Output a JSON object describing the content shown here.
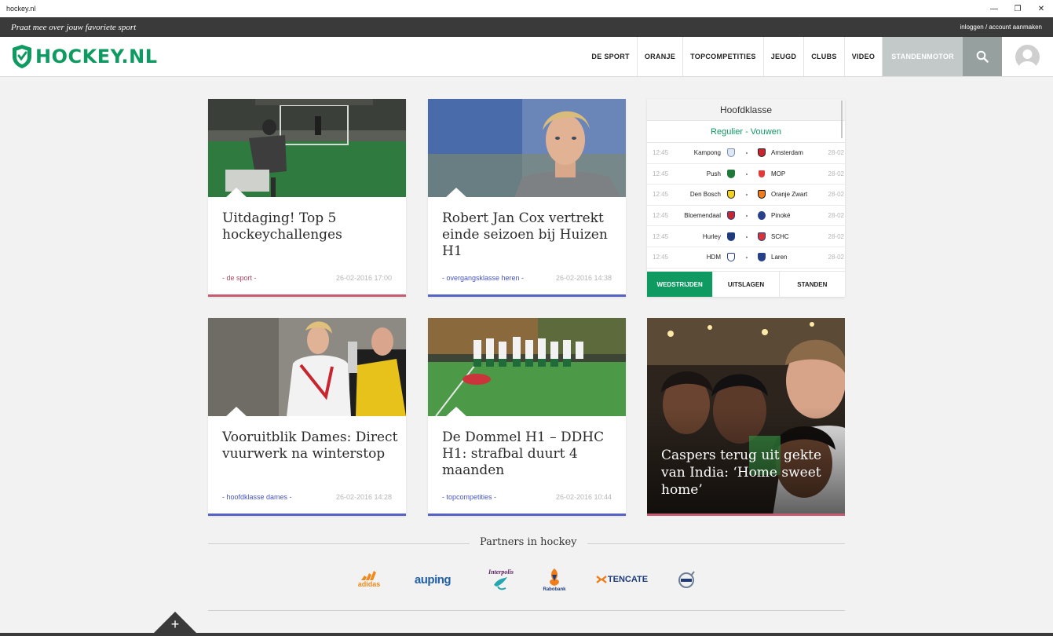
{
  "window": {
    "title": "hockey.nl"
  },
  "topbar": {
    "slogan": "Praat mee over jouw favoriete sport",
    "login": "inloggen / account aanmaken"
  },
  "brand": {
    "name": "HOCKEY.NL",
    "color": "#0e9a61"
  },
  "nav": {
    "items": [
      "DE SPORT",
      "ORANJE",
      "TOPCOMPETITIES",
      "JEUGD",
      "CLUBS",
      "VIDEO",
      "STANDENMOTOR"
    ],
    "active": "STANDENMOTOR",
    "icons": [
      "search-icon",
      "user-avatar-icon"
    ]
  },
  "cards": [
    {
      "title": "Uitdaging! Top 5 hockeychallenges",
      "category": "- de sport -",
      "date": "26-02-2016 17:00",
      "accent": "#c75b72"
    },
    {
      "title": "Robert Jan Cox vertrekt einde seizoen bij Huizen H1",
      "category": "- overgangsklasse heren -",
      "date": "26-02-2016 14:38",
      "accent": "#5563c7"
    },
    {
      "title": "Vooruitblik Dames: Direct vuurwerk na winterstop",
      "category": "- hoofdklasse dames -",
      "date": "26-02-2016 14:28",
      "accent": "#5563c7"
    },
    {
      "title": "De Dommel H1 – DDHC H1: strafbal duurt 4 maanden",
      "category": "- topcompetities -",
      "date": "26-02-2016 10:44",
      "accent": "#5563c7"
    }
  ],
  "feature": {
    "title": "Caspers terug uit gekte van India: ‘Home sweet home’"
  },
  "widget": {
    "title": "Hoofdklasse",
    "subtitle": "Regulier - Vouwen",
    "matches": [
      {
        "time": "12:45",
        "home": "Kampong",
        "away": "Amsterdam",
        "date": "28-02"
      },
      {
        "time": "12:45",
        "home": "Push",
        "away": "MOP",
        "date": "28-02"
      },
      {
        "time": "12:45",
        "home": "Den Bosch",
        "away": "Oranje Zwart",
        "date": "28-02"
      },
      {
        "time": "12:45",
        "home": "Bloemendaal",
        "away": "Pinoké",
        "date": "28-02"
      },
      {
        "time": "12:45",
        "home": "Hurley",
        "away": "SCHC",
        "date": "28-02"
      },
      {
        "time": "12:45",
        "home": "HDM",
        "away": "Laren",
        "date": "28-02"
      }
    ],
    "separator": "-",
    "tabs": [
      "WEDSTRIJDEN",
      "UITSLAGEN",
      "STANDEN"
    ],
    "active_tab": "WEDSTRIJDEN"
  },
  "partners": {
    "title": "Partners in hockey",
    "logos": [
      "adidas",
      "auping",
      "Interpolis",
      "Rabobank",
      "TENCATE",
      "Volvo"
    ]
  },
  "footer": {
    "plus": "+"
  }
}
